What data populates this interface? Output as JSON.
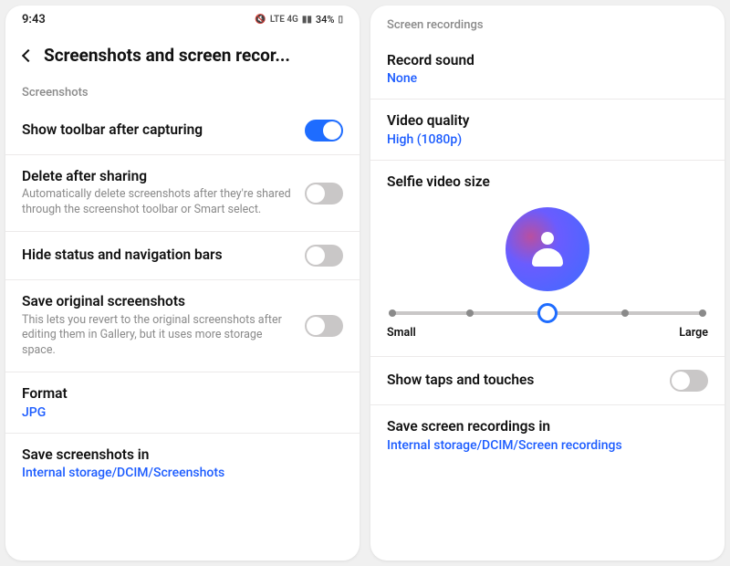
{
  "status": {
    "time": "9:43",
    "battery": "34%",
    "icons": "⨉ᵥₒ ᴸᵀᴱ ⁴ᴳ 📶"
  },
  "left": {
    "title": "Screenshots and screen recor...",
    "section": "Screenshots",
    "showToolbar": {
      "title": "Show toolbar after capturing",
      "on": true
    },
    "deleteAfter": {
      "title": "Delete after sharing",
      "desc": "Automatically delete screenshots after they're shared through the screenshot toolbar or Smart select.",
      "on": false
    },
    "hideBars": {
      "title": "Hide status and navigation bars",
      "on": false
    },
    "saveOriginal": {
      "title": "Save original screenshots",
      "desc": "This lets you revert to the original screenshots after editing them in Gallery, but it uses more storage space.",
      "on": false
    },
    "format": {
      "title": "Format",
      "value": "JPG"
    },
    "saveIn": {
      "title": "Save screenshots in",
      "value": "Internal storage/DCIM/Screenshots"
    }
  },
  "right": {
    "section": "Screen recordings",
    "recordSound": {
      "title": "Record sound",
      "value": "None"
    },
    "videoQuality": {
      "title": "Video quality",
      "value": "High (1080p)"
    },
    "selfieSize": {
      "title": "Selfie video size",
      "min": "Small",
      "max": "Large"
    },
    "showTaps": {
      "title": "Show taps and touches",
      "on": false
    },
    "saveIn": {
      "title": "Save screen recordings in",
      "value": "Internal storage/DCIM/Screen recordings"
    }
  }
}
